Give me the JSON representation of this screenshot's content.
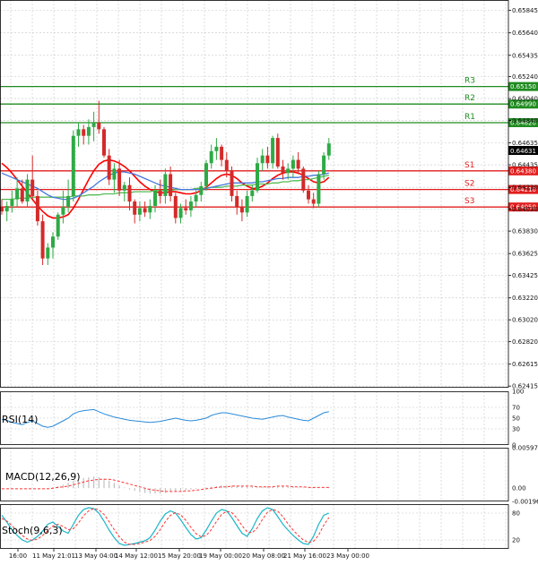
{
  "colors": {
    "bull": "#2eaa45",
    "bear": "#d42a2a",
    "resistance": "#1f8c1f",
    "support": "#e21d1d",
    "ma_red": "#ff0000",
    "ma_green": "#55bb55",
    "ma_blue": "#4477dd",
    "rsi": "#2a8ad8",
    "macd_hist": "#c0c0c0",
    "macd_signal": "#ff3333",
    "stoch_main": "#1ab6c8",
    "stoch_signal": "#ff3333",
    "grid": "#c8c8c8",
    "last_price_bg": "#000000"
  },
  "chart_data": [
    {
      "type": "candlestick",
      "pane": "price",
      "ylim": [
        0.624,
        0.6594
      ],
      "y_ticks": [
        "0.65845",
        "0.65640",
        "0.65435",
        "0.65240",
        "0.65040",
        "0.64840",
        "0.64635",
        "0.64435",
        "0.64230",
        "0.64030",
        "0.63830",
        "0.63625",
        "0.63425",
        "0.63220",
        "0.63020",
        "0.62820",
        "0.62615",
        "0.62415"
      ],
      "last_price": "0.64631",
      "levels": [
        {
          "name": "R3",
          "value": 0.6515,
          "label": "0.65150",
          "kind": "resistance"
        },
        {
          "name": "R2",
          "value": 0.6499,
          "label": "0.64990",
          "kind": "resistance"
        },
        {
          "name": "R1",
          "value": 0.6482,
          "label": "0.64820",
          "kind": "resistance"
        },
        {
          "name": "S1",
          "value": 0.6438,
          "label": "0.64380",
          "kind": "support"
        },
        {
          "name": "S2",
          "value": 0.6421,
          "label": "0.64210",
          "kind": "support"
        },
        {
          "name": "S3",
          "value": 0.6405,
          "label": "0.64050",
          "kind": "support"
        }
      ],
      "candles": [
        [
          0.6405,
          0.6412,
          0.6398,
          0.6401
        ],
        [
          0.6401,
          0.641,
          0.6392,
          0.6406
        ],
        [
          0.6406,
          0.642,
          0.64,
          0.6412
        ],
        [
          0.6412,
          0.6432,
          0.6405,
          0.6422
        ],
        [
          0.6422,
          0.643,
          0.6408,
          0.641
        ],
        [
          0.641,
          0.6435,
          0.6405,
          0.643
        ],
        [
          0.643,
          0.6452,
          0.6412,
          0.6415
        ],
        [
          0.6415,
          0.642,
          0.6388,
          0.6392
        ],
        [
          0.6392,
          0.6398,
          0.6352,
          0.6358
        ],
        [
          0.6358,
          0.6372,
          0.6352,
          0.6368
        ],
        [
          0.6368,
          0.6382,
          0.6358,
          0.6378
        ],
        [
          0.6378,
          0.64,
          0.6375,
          0.6398
        ],
        [
          0.6398,
          0.642,
          0.639,
          0.6405
        ],
        [
          0.6405,
          0.643,
          0.64,
          0.6415
        ],
        [
          0.6415,
          0.6475,
          0.641,
          0.647
        ],
        [
          0.647,
          0.6482,
          0.646,
          0.6476
        ],
        [
          0.6476,
          0.648,
          0.6462,
          0.647
        ],
        [
          0.647,
          0.6485,
          0.6462,
          0.6478
        ],
        [
          0.6478,
          0.6492,
          0.6465,
          0.6482
        ],
        [
          0.6482,
          0.6502,
          0.6472,
          0.6476
        ],
        [
          0.6476,
          0.6478,
          0.645,
          0.6452
        ],
        [
          0.6452,
          0.6458,
          0.6425,
          0.643
        ],
        [
          0.643,
          0.6445,
          0.6418,
          0.644
        ],
        [
          0.644,
          0.6448,
          0.6415,
          0.642
        ],
        [
          0.642,
          0.6428,
          0.641,
          0.6425
        ],
        [
          0.6425,
          0.6432,
          0.6402,
          0.641
        ],
        [
          0.641,
          0.6412,
          0.639,
          0.6398
        ],
        [
          0.6398,
          0.641,
          0.6392,
          0.6404
        ],
        [
          0.6404,
          0.641,
          0.6396,
          0.64
        ],
        [
          0.64,
          0.6412,
          0.6394,
          0.6406
        ],
        [
          0.6406,
          0.6425,
          0.64,
          0.642
        ],
        [
          0.642,
          0.643,
          0.6408,
          0.6415
        ],
        [
          0.6415,
          0.644,
          0.6408,
          0.6435
        ],
        [
          0.6435,
          0.6442,
          0.641,
          0.6415
        ],
        [
          0.6415,
          0.6418,
          0.639,
          0.6395
        ],
        [
          0.6395,
          0.6408,
          0.639,
          0.6404
        ],
        [
          0.6404,
          0.6412,
          0.6398,
          0.6402
        ],
        [
          0.6402,
          0.6415,
          0.6396,
          0.641
        ],
        [
          0.641,
          0.642,
          0.6405,
          0.6416
        ],
        [
          0.6416,
          0.6428,
          0.641,
          0.6424
        ],
        [
          0.6424,
          0.6448,
          0.642,
          0.6445
        ],
        [
          0.6445,
          0.6462,
          0.644,
          0.6456
        ],
        [
          0.6456,
          0.6468,
          0.6448,
          0.646
        ],
        [
          0.646,
          0.6462,
          0.6442,
          0.6448
        ],
        [
          0.6448,
          0.6455,
          0.6432,
          0.6438
        ],
        [
          0.6438,
          0.6442,
          0.641,
          0.6415
        ],
        [
          0.6415,
          0.642,
          0.6398,
          0.6405
        ],
        [
          0.6405,
          0.6412,
          0.6392,
          0.64
        ],
        [
          0.64,
          0.642,
          0.6396,
          0.6415
        ],
        [
          0.6415,
          0.6425,
          0.641,
          0.642
        ],
        [
          0.642,
          0.645,
          0.6418,
          0.6445
        ],
        [
          0.6445,
          0.6458,
          0.6438,
          0.6452
        ],
        [
          0.6452,
          0.646,
          0.644,
          0.6445
        ],
        [
          0.6445,
          0.647,
          0.644,
          0.6468
        ],
        [
          0.6468,
          0.6472,
          0.644,
          0.6442
        ],
        [
          0.6442,
          0.6448,
          0.643,
          0.6436
        ],
        [
          0.6436,
          0.6445,
          0.643,
          0.644
        ],
        [
          0.644,
          0.6452,
          0.6432,
          0.6448
        ],
        [
          0.6448,
          0.6455,
          0.6435,
          0.644
        ],
        [
          0.644,
          0.6442,
          0.6418,
          0.642
        ],
        [
          0.642,
          0.6425,
          0.6408,
          0.6412
        ],
        [
          0.6412,
          0.6418,
          0.6404,
          0.6408
        ],
        [
          0.6408,
          0.6438,
          0.6405,
          0.6435
        ],
        [
          0.6435,
          0.6455,
          0.643,
          0.6452
        ],
        [
          0.6452,
          0.6468,
          0.6448,
          0.6463
        ]
      ],
      "ma_red": [
        0.6445,
        0.6441,
        0.6436,
        0.643,
        0.6424,
        0.6418,
        0.6412,
        0.6406,
        0.6401,
        0.6397,
        0.6395,
        0.6395,
        0.6396,
        0.6398,
        0.6404,
        0.6412,
        0.6421,
        0.643,
        0.6438,
        0.6444,
        0.6447,
        0.6448,
        0.6447,
        0.6445,
        0.6442,
        0.6438,
        0.6433,
        0.6428,
        0.6424,
        0.6421,
        0.6419,
        0.6418,
        0.6418,
        0.6419,
        0.6419,
        0.6418,
        0.6417,
        0.6417,
        0.6418,
        0.642,
        0.6423,
        0.6427,
        0.6431,
        0.6434,
        0.6435,
        0.6434,
        0.6431,
        0.6427,
        0.6424,
        0.6422,
        0.6422,
        0.6424,
        0.6427,
        0.6431,
        0.6434,
        0.6436,
        0.6437,
        0.6437,
        0.6436,
        0.6434,
        0.6431,
        0.6428,
        0.6427,
        0.6428,
        0.6432
      ],
      "ma_blue": [
        0.6436,
        0.6434,
        0.6432,
        0.643,
        0.6428,
        0.6426,
        0.6424,
        0.6422,
        0.6419,
        0.6416,
        0.6414,
        0.6413,
        0.6412,
        0.6412,
        0.6413,
        0.6415,
        0.6418,
        0.6421,
        0.6424,
        0.6428,
        0.6431,
        0.6434,
        0.6436,
        0.6437,
        0.6437,
        0.6436,
        0.6435,
        0.6433,
        0.6431,
        0.6429,
        0.6427,
        0.6425,
        0.6424,
        0.6423,
        0.6422,
        0.6421,
        0.6421,
        0.6421,
        0.6421,
        0.6421,
        0.6422,
        0.6423,
        0.6424,
        0.6425,
        0.6426,
        0.6427,
        0.6427,
        0.6427,
        0.6427,
        0.6427,
        0.6428,
        0.6428,
        0.6429,
        0.643,
        0.6431,
        0.6431,
        0.6432,
        0.6432,
        0.6432,
        0.6433,
        0.6433,
        0.6434,
        0.6434,
        0.6435,
        0.6436
      ],
      "ma_green": [
        0.6412,
        0.6412,
        0.6412,
        0.6413,
        0.6413,
        0.6413,
        0.6414,
        0.6414,
        0.6414,
        0.6414,
        0.6414,
        0.6414,
        0.6414,
        0.6414,
        0.6415,
        0.6415,
        0.6415,
        0.6416,
        0.6416,
        0.6416,
        0.6417,
        0.6417,
        0.6417,
        0.6418,
        0.6418,
        0.6418,
        0.6419,
        0.6419,
        0.6419,
        0.6419,
        0.642,
        0.642,
        0.642,
        0.642,
        0.6421,
        0.6421,
        0.6421,
        0.6421,
        0.6422,
        0.6422,
        0.6422,
        0.6423,
        0.6423,
        0.6423,
        0.6424,
        0.6424,
        0.6424,
        0.6425,
        0.6425,
        0.6425,
        0.6426,
        0.6426,
        0.6426,
        0.6427,
        0.6427,
        0.6428,
        0.6428,
        0.6429,
        0.6429,
        0.643,
        0.643,
        0.6431,
        0.6432,
        0.6433,
        0.6434
      ]
    },
    {
      "type": "line",
      "pane": "rsi",
      "title": "RSI(14)",
      "ylim": [
        0,
        100
      ],
      "y_ticks": [
        "100",
        "70",
        "50",
        "30",
        "0"
      ],
      "values": [
        48,
        46,
        42,
        40,
        38,
        42,
        45,
        40,
        35,
        33,
        35,
        40,
        45,
        50,
        58,
        62,
        64,
        65,
        66,
        62,
        58,
        55,
        52,
        50,
        48,
        46,
        45,
        44,
        43,
        42,
        43,
        44,
        46,
        48,
        50,
        48,
        46,
        45,
        46,
        48,
        50,
        55,
        58,
        60,
        60,
        58,
        56,
        54,
        52,
        50,
        49,
        48,
        50,
        52,
        54,
        55,
        52,
        50,
        48,
        46,
        45,
        50,
        55,
        60,
        62
      ]
    },
    {
      "type": "bar",
      "pane": "macd",
      "title": "MACD(12,26,9)",
      "ylim": [
        -0.001962,
        0.005976
      ],
      "y_ticks": [
        "0.005976",
        "0.00",
        "-0.001962"
      ],
      "values": [
        0.0,
        0.0,
        0.0,
        0.0,
        0.0,
        0.0,
        0.0,
        0.0,
        0.0,
        0.0,
        0.0001,
        0.0003,
        0.0005,
        0.0008,
        0.0011,
        0.0013,
        0.0015,
        0.0016,
        0.0017,
        0.0016,
        0.0014,
        0.0011,
        0.0008,
        0.0004,
        0.0001,
        -0.0002,
        -0.0004,
        -0.0006,
        -0.0007,
        -0.0008,
        -0.0008,
        -0.0008,
        -0.0007,
        -0.0006,
        -0.0005,
        -0.0004,
        -0.0003,
        -0.0002,
        -0.0001,
        0.0,
        0.0001,
        0.0002,
        0.0003,
        0.0004,
        0.0004,
        0.0004,
        0.0003,
        0.0003,
        0.0002,
        0.0002,
        0.0002,
        0.0002,
        0.0003,
        0.0003,
        0.0003,
        0.0003,
        0.0002,
        0.0002,
        0.0001,
        0.0001,
        0.0001,
        0.0001,
        0.0001,
        0.0001,
        0.0001
      ],
      "signal": [
        -0.0001,
        -0.0001,
        -0.0001,
        -0.0001,
        -0.0001,
        -0.0001,
        -0.0001,
        -0.0001,
        -0.0001,
        -0.0001,
        0.0,
        0.0001,
        0.0002,
        0.0003,
        0.0005,
        0.0007,
        0.0009,
        0.0011,
        0.0012,
        0.0013,
        0.0013,
        0.0013,
        0.0012,
        0.001,
        0.0008,
        0.0006,
        0.0004,
        0.0002,
        0.0,
        -0.0002,
        -0.0003,
        -0.0004,
        -0.0005,
        -0.0005,
        -0.0005,
        -0.0005,
        -0.0004,
        -0.0004,
        -0.0003,
        -0.0002,
        -0.0001,
        0.0,
        0.0001,
        0.0002,
        0.0002,
        0.0003,
        0.0003,
        0.0003,
        0.0003,
        0.0003,
        0.0002,
        0.0002,
        0.0002,
        0.0002,
        0.0003,
        0.0003,
        0.0003,
        0.0002,
        0.0002,
        0.0002,
        0.0001,
        0.0001,
        0.0001,
        0.0001,
        0.0001
      ]
    },
    {
      "type": "line",
      "pane": "stoch",
      "title": "Stoch(9,6,3)",
      "ylim": [
        0,
        100
      ],
      "y_ticks": [
        "80",
        "20"
      ],
      "main": [
        75,
        60,
        42,
        30,
        20,
        15,
        20,
        28,
        40,
        55,
        60,
        50,
        40,
        35,
        55,
        75,
        88,
        92,
        90,
        80,
        62,
        42,
        25,
        12,
        8,
        10,
        12,
        15,
        18,
        25,
        42,
        62,
        78,
        85,
        80,
        65,
        48,
        32,
        22,
        25,
        42,
        62,
        80,
        88,
        85,
        70,
        52,
        35,
        28,
        45,
        68,
        85,
        92,
        88,
        72,
        55,
        42,
        30,
        20,
        12,
        10,
        28,
        55,
        75,
        80
      ],
      "signal": [
        68,
        62,
        52,
        40,
        30,
        22,
        19,
        22,
        30,
        41,
        51,
        55,
        50,
        43,
        45,
        58,
        74,
        85,
        90,
        87,
        77,
        61,
        43,
        27,
        15,
        10,
        10,
        12,
        15,
        19,
        28,
        43,
        61,
        75,
        81,
        76,
        64,
        48,
        34,
        27,
        30,
        43,
        61,
        77,
        84,
        81,
        69,
        52,
        38,
        36,
        47,
        66,
        82,
        88,
        84,
        72,
        56,
        42,
        30,
        20,
        14,
        17,
        31,
        53,
        70
      ]
    }
  ],
  "x_axis_labels": [
    "16:00",
    "11 May 21:01",
    "13 May 04:00",
    "14 May 12:00",
    "15 May 20:00",
    "19 May 00:00",
    "20 May 08:00",
    "21 May 16:00",
    "23 May 00:00"
  ]
}
